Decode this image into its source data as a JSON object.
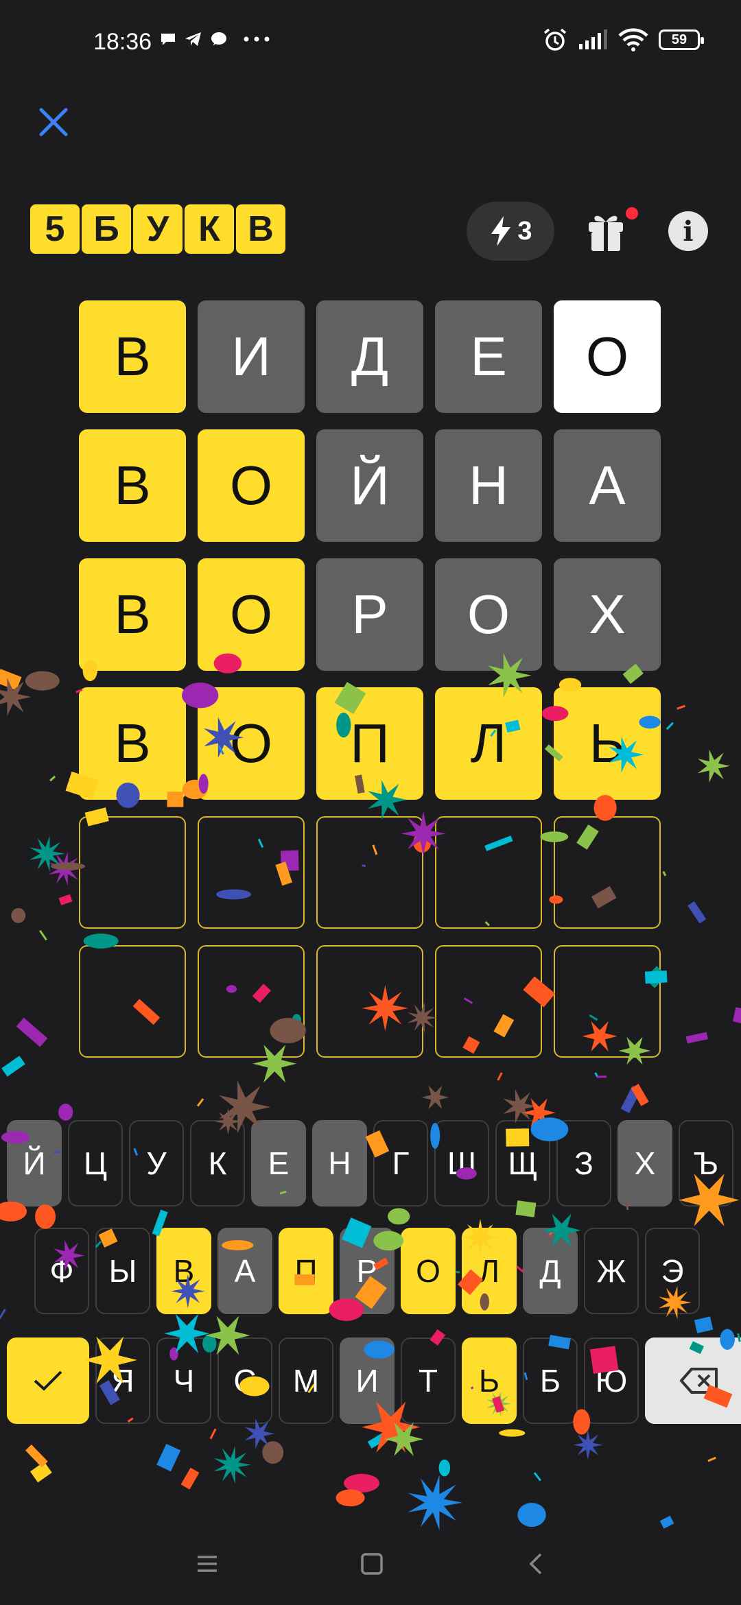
{
  "status_bar": {
    "time": "18:36",
    "battery": "59",
    "left_icons": [
      "chat-bubble-icon",
      "telegram-icon",
      "message-icon",
      "more-dots-icon"
    ],
    "right_icons": [
      "alarm-icon",
      "signal-icon",
      "wifi-icon",
      "battery-icon"
    ]
  },
  "header": {
    "close_icon": "close-icon",
    "logo_letters": [
      "5",
      "Б",
      "У",
      "К",
      "В"
    ],
    "hints_count": "3",
    "hints_icon": "bolt-icon",
    "gift_icon": "gift-icon",
    "info_label": "i"
  },
  "board": {
    "rows": [
      [
        {
          "letter": "В",
          "state": "yellow"
        },
        {
          "letter": "И",
          "state": "gray"
        },
        {
          "letter": "Д",
          "state": "gray"
        },
        {
          "letter": "Е",
          "state": "gray"
        },
        {
          "letter": "О",
          "state": "white"
        }
      ],
      [
        {
          "letter": "В",
          "state": "yellow"
        },
        {
          "letter": "О",
          "state": "yellow"
        },
        {
          "letter": "Й",
          "state": "gray"
        },
        {
          "letter": "Н",
          "state": "gray"
        },
        {
          "letter": "А",
          "state": "gray"
        }
      ],
      [
        {
          "letter": "В",
          "state": "yellow"
        },
        {
          "letter": "О",
          "state": "yellow"
        },
        {
          "letter": "Р",
          "state": "gray"
        },
        {
          "letter": "О",
          "state": "gray"
        },
        {
          "letter": "Х",
          "state": "gray"
        }
      ],
      [
        {
          "letter": "В",
          "state": "yellow"
        },
        {
          "letter": "О",
          "state": "yellow"
        },
        {
          "letter": "П",
          "state": "yellow"
        },
        {
          "letter": "Л",
          "state": "yellow"
        },
        {
          "letter": "Ь",
          "state": "yellow"
        }
      ],
      [
        {
          "letter": "",
          "state": "empty"
        },
        {
          "letter": "",
          "state": "empty"
        },
        {
          "letter": "",
          "state": "empty"
        },
        {
          "letter": "",
          "state": "empty"
        },
        {
          "letter": "",
          "state": "empty"
        }
      ],
      [
        {
          "letter": "",
          "state": "empty"
        },
        {
          "letter": "",
          "state": "empty"
        },
        {
          "letter": "",
          "state": "empty"
        },
        {
          "letter": "",
          "state": "empty"
        },
        {
          "letter": "",
          "state": "empty"
        }
      ]
    ]
  },
  "keyboard": {
    "row1": [
      {
        "k": "Й",
        "s": "gray"
      },
      {
        "k": "Ц",
        "s": "default"
      },
      {
        "k": "У",
        "s": "default"
      },
      {
        "k": "К",
        "s": "default"
      },
      {
        "k": "Е",
        "s": "gray"
      },
      {
        "k": "Н",
        "s": "gray"
      },
      {
        "k": "Г",
        "s": "default"
      },
      {
        "k": "Ш",
        "s": "default"
      },
      {
        "k": "Щ",
        "s": "default"
      },
      {
        "k": "З",
        "s": "default"
      },
      {
        "k": "Х",
        "s": "gray"
      },
      {
        "k": "Ъ",
        "s": "default"
      }
    ],
    "row2": [
      {
        "k": "Ф",
        "s": "default"
      },
      {
        "k": "Ы",
        "s": "default"
      },
      {
        "k": "В",
        "s": "yellow"
      },
      {
        "k": "А",
        "s": "gray"
      },
      {
        "k": "П",
        "s": "yellow"
      },
      {
        "k": "Р",
        "s": "gray"
      },
      {
        "k": "О",
        "s": "yellow"
      },
      {
        "k": "Л",
        "s": "yellow"
      },
      {
        "k": "Д",
        "s": "gray"
      },
      {
        "k": "Ж",
        "s": "default"
      },
      {
        "k": "Э",
        "s": "default"
      }
    ],
    "row3": [
      {
        "k": "",
        "s": "enter"
      },
      {
        "k": "Я",
        "s": "default"
      },
      {
        "k": "Ч",
        "s": "default"
      },
      {
        "k": "С",
        "s": "default"
      },
      {
        "k": "М",
        "s": "default"
      },
      {
        "k": "И",
        "s": "gray"
      },
      {
        "k": "Т",
        "s": "default"
      },
      {
        "k": "Ь",
        "s": "yellow"
      },
      {
        "k": "Б",
        "s": "default"
      },
      {
        "k": "Ю",
        "s": "default"
      },
      {
        "k": "",
        "s": "backspace"
      }
    ],
    "enter_icon": "checkmark-icon",
    "backspace_icon": "backspace-icon"
  },
  "nav_bar": {
    "icons": [
      "menu-icon",
      "home-icon",
      "back-icon"
    ]
  },
  "colors": {
    "background": "#1c1c1e",
    "yellow": "#ffdd2d",
    "gray": "#616161",
    "accent_blue": "#3b82f6"
  }
}
